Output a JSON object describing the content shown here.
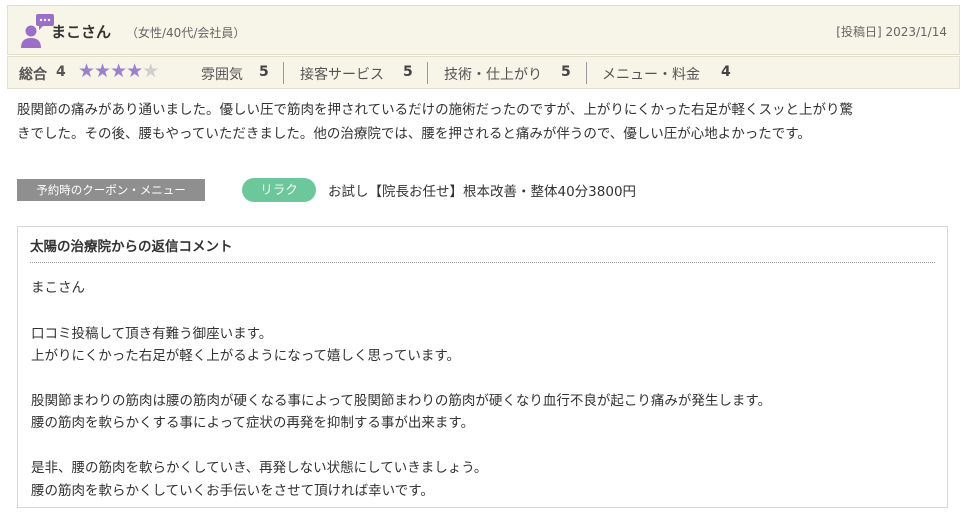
{
  "review": {
    "reviewer_name": "まこさん",
    "reviewer_attrs": "（女性/40代/会社員）",
    "post_date": "[投稿日] 2023/1/14",
    "icon": "user-avatar-with-chat-bubble-icon"
  },
  "ratings": {
    "overall_label": "総合",
    "overall_value": "4",
    "overall_stars": 4,
    "max_stars": 5,
    "items": [
      {
        "label": "雰囲気",
        "value": "5"
      },
      {
        "label": "接客サービス",
        "value": "5"
      },
      {
        "label": "技術・仕上がり",
        "value": "5"
      },
      {
        "label": "メニュー・料金",
        "value": "4"
      }
    ]
  },
  "body": {
    "lines": [
      "股関節の痛みがあり通いました。優しい圧で筋肉を押されているだけの施術だったのですが、上がりにくかった右足が軽くスッと上がり驚",
      "きでした。その後、腰もやっていただきました。他の治療院では、腰を押されると痛みが伴うので、優しい圧が心地よかったです。"
    ]
  },
  "coupon": {
    "label": "予約時のクーポン・メニュー",
    "tag": "リラク",
    "text": "お試し【院長お任せ】根本改善・整体40分3800円"
  },
  "reply": {
    "title": "太陽の治療院からの返信コメント",
    "lines": [
      "まこさん",
      "",
      "口コミ投稿して頂き有難う御座います。",
      "上がりにくかった右足が軽く上がるようになって嬉しく思っています。",
      "",
      "股関節まわりの筋肉は腰の筋肉が硬くなる事によって股関節まわりの筋肉が硬くなり血行不良が起こり痛みが発生します。",
      "腰の筋肉を軟らかくする事によって症状の再発を抑制する事が出来ます。",
      "",
      "是非、腰の筋肉を軟らかくしていき、再発しない状態にしていきましょう。",
      "腰の筋肉を軟らかくしていくお手伝いをさせて頂ければ幸いです。"
    ]
  },
  "colors": {
    "header_bg": "#f7f4e8",
    "star_on": "#9b83c9",
    "star_off": "#cfcfcf",
    "tag_green": "#6cc79a",
    "coupon_label_bg": "#8f8f8f"
  }
}
